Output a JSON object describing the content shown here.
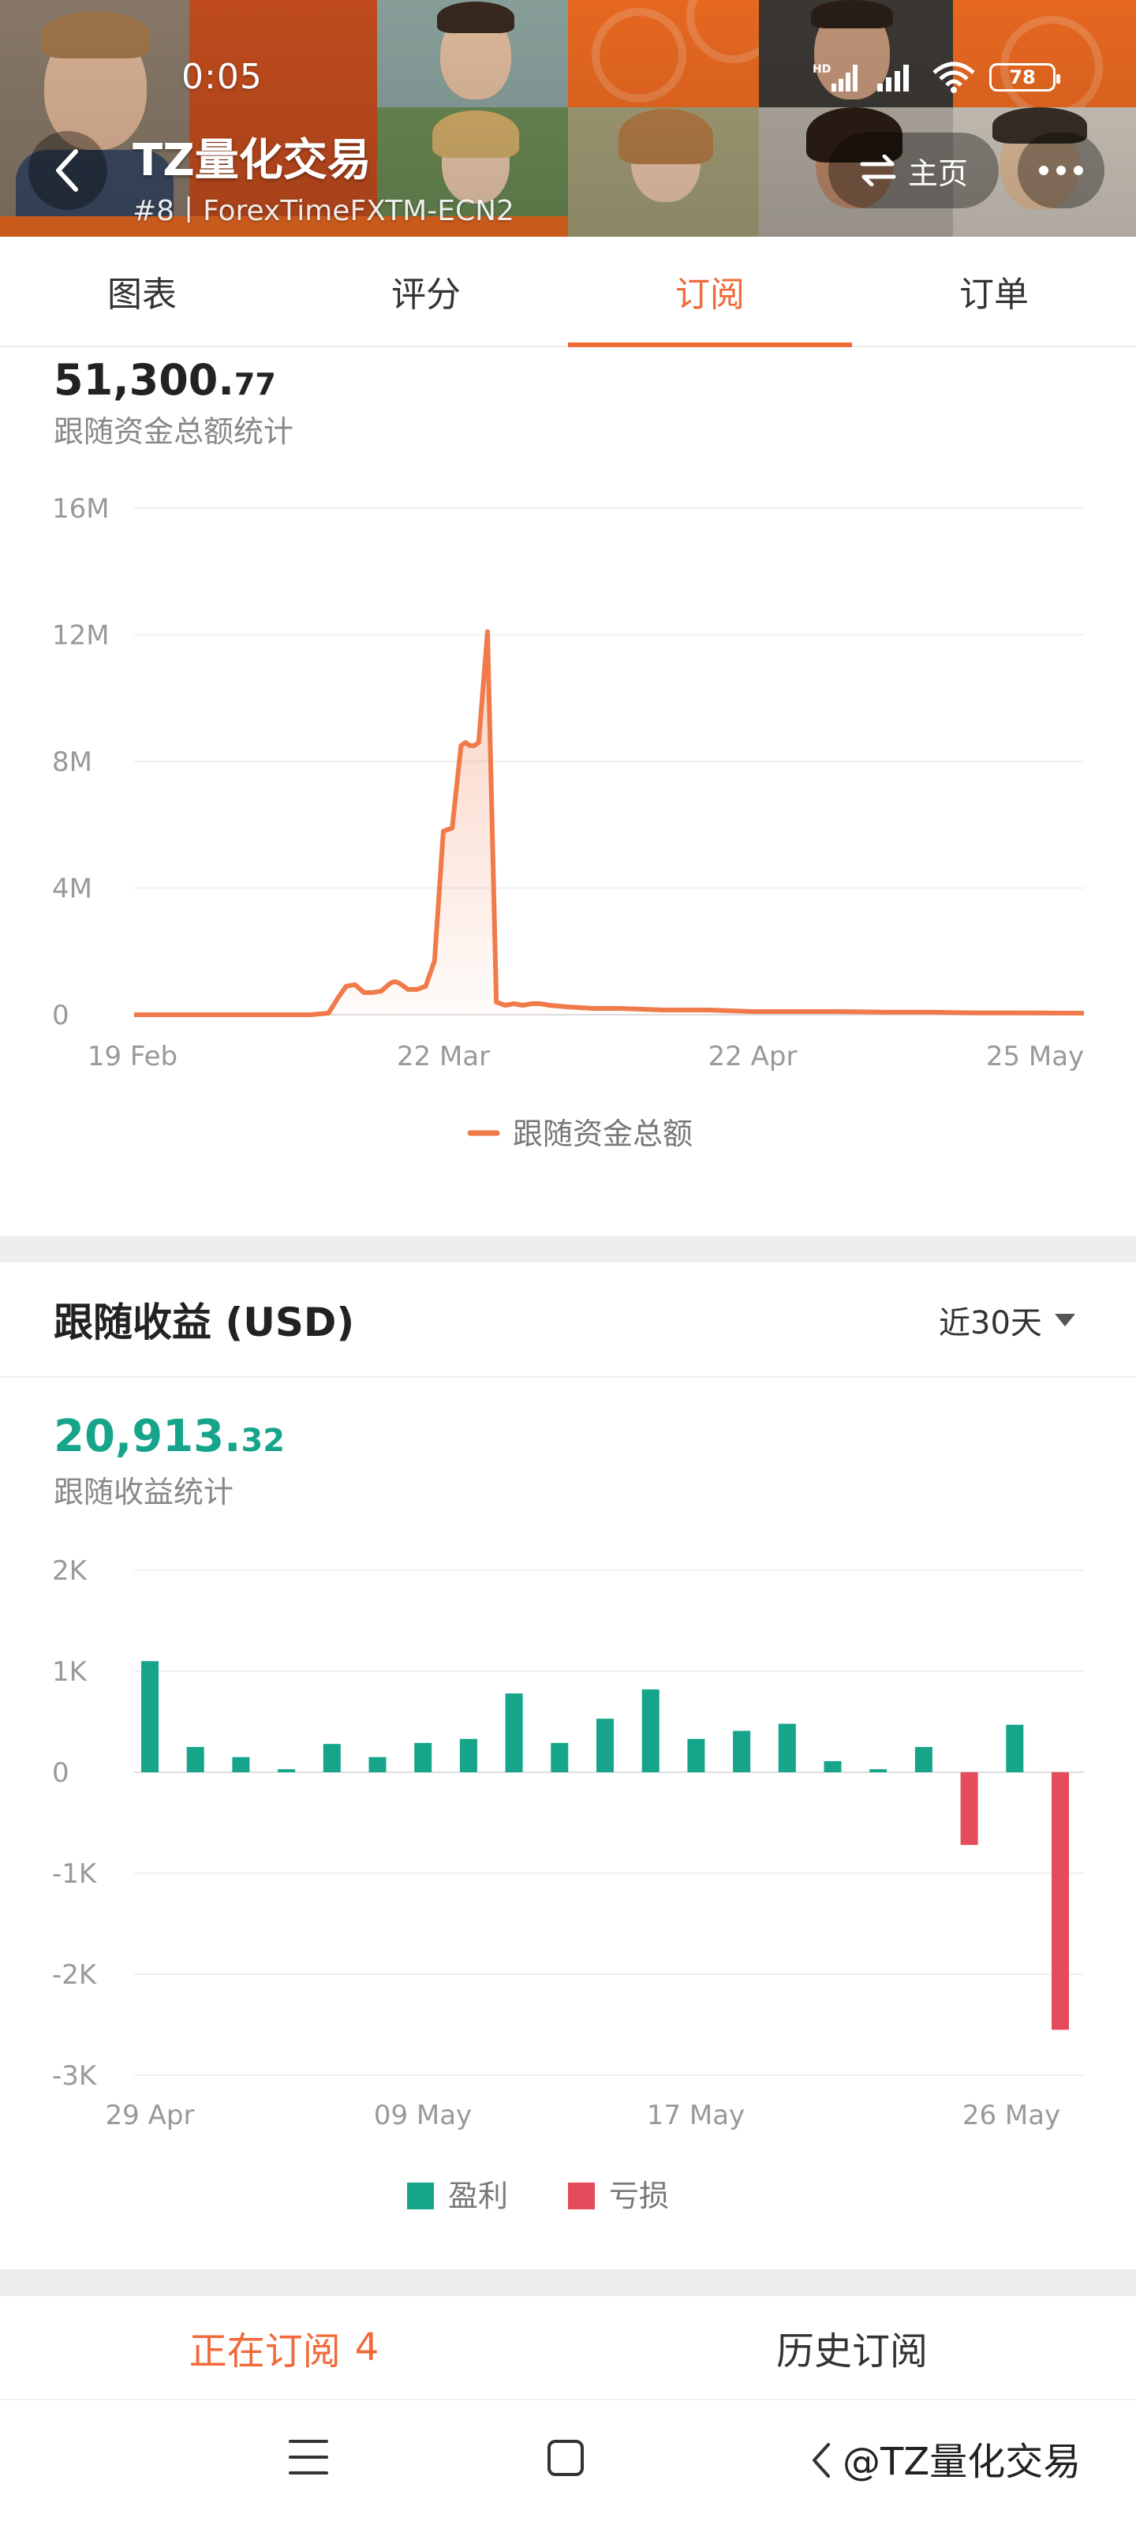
{
  "status_bar": {
    "time": "0:05",
    "network_badge": "HD",
    "battery": "78",
    "icons": [
      "signal-icon",
      "signal-icon",
      "wifi-icon",
      "battery-icon"
    ]
  },
  "header": {
    "title": "TZ量化交易",
    "subtitle": "#8丨ForexTimeFXTM-ECN2",
    "home_label": "主页",
    "background": "photo-mosaic",
    "accent": "#f06a3a"
  },
  "tabs": [
    {
      "label": "图表",
      "active": false
    },
    {
      "label": "评分",
      "active": false
    },
    {
      "label": "订阅",
      "active": true
    },
    {
      "label": "订单",
      "active": false
    }
  ],
  "fund_section": {
    "total_int": "51,300.",
    "total_dec": "77",
    "label": "跟随资金总额统计",
    "legend": "跟随资金总额",
    "color": "#f07a4a"
  },
  "profit_section": {
    "title": "跟随收益 (USD)",
    "range": "近30天",
    "total_int": "20,913.",
    "total_dec": "32",
    "label": "跟随收益统计",
    "legend_profit": "盈利",
    "legend_loss": "亏损",
    "profit_color": "#16a58a",
    "loss_color": "#e44b5b"
  },
  "subscription_tabs": {
    "current_label": "正在订阅",
    "current_count": "4",
    "history_label": "历史订阅"
  },
  "nav": {
    "watermark": "@TZ量化交易"
  },
  "chart_data": [
    {
      "type": "area",
      "title": "",
      "xlabel": "",
      "ylabel": "",
      "x_ticks": [
        "19 Feb",
        "22 Mar",
        "22 Apr",
        "25 May"
      ],
      "y_ticks": [
        "0",
        "4M",
        "8M",
        "12M",
        "16M"
      ],
      "ylim": [
        0,
        16000000
      ],
      "grid": true,
      "legend_placement": "bottom-center",
      "series": [
        {
          "name": "跟随资金总额",
          "x": [
            0,
            10,
            20,
            30,
            40,
            44,
            46,
            48,
            50,
            52,
            54,
            56,
            58,
            59,
            60,
            62,
            64,
            66,
            68,
            70,
            72,
            74,
            75,
            76,
            77,
            78,
            80,
            82,
            84,
            86,
            88,
            90,
            92,
            94,
            98,
            104,
            110,
            120,
            130,
            140,
            150,
            160,
            170,
            180,
            190,
            200,
            215
          ],
          "y": [
            0,
            0,
            0,
            0,
            0,
            50000,
            500000,
            900000,
            950000,
            700000,
            700000,
            750000,
            1000000,
            1050000,
            1000000,
            800000,
            800000,
            900000,
            1700000,
            5800000,
            5900000,
            8500000,
            8600000,
            8500000,
            8500000,
            8600000,
            12100000,
            400000,
            300000,
            350000,
            300000,
            350000,
            350000,
            300000,
            250000,
            200000,
            200000,
            150000,
            150000,
            100000,
            100000,
            100000,
            80000,
            80000,
            60000,
            60000,
            50000
          ]
        }
      ]
    },
    {
      "type": "bar",
      "title": "",
      "xlabel": "",
      "ylabel": "",
      "x_ticks": [
        "29 Apr",
        "09 May",
        "17 May",
        "26 May"
      ],
      "y_ticks": [
        "2K",
        "1K",
        "0",
        "-1K",
        "-2K",
        "-3K"
      ],
      "ylim": [
        -3000,
        2000
      ],
      "grid": true,
      "legend_placement": "bottom-center",
      "series": [
        {
          "name": "盈利/亏损",
          "values": [
            1100,
            250,
            150,
            30,
            280,
            150,
            290,
            330,
            780,
            290,
            530,
            820,
            330,
            410,
            480,
            110,
            30,
            250,
            -720,
            470,
            -2550
          ]
        }
      ]
    }
  ]
}
